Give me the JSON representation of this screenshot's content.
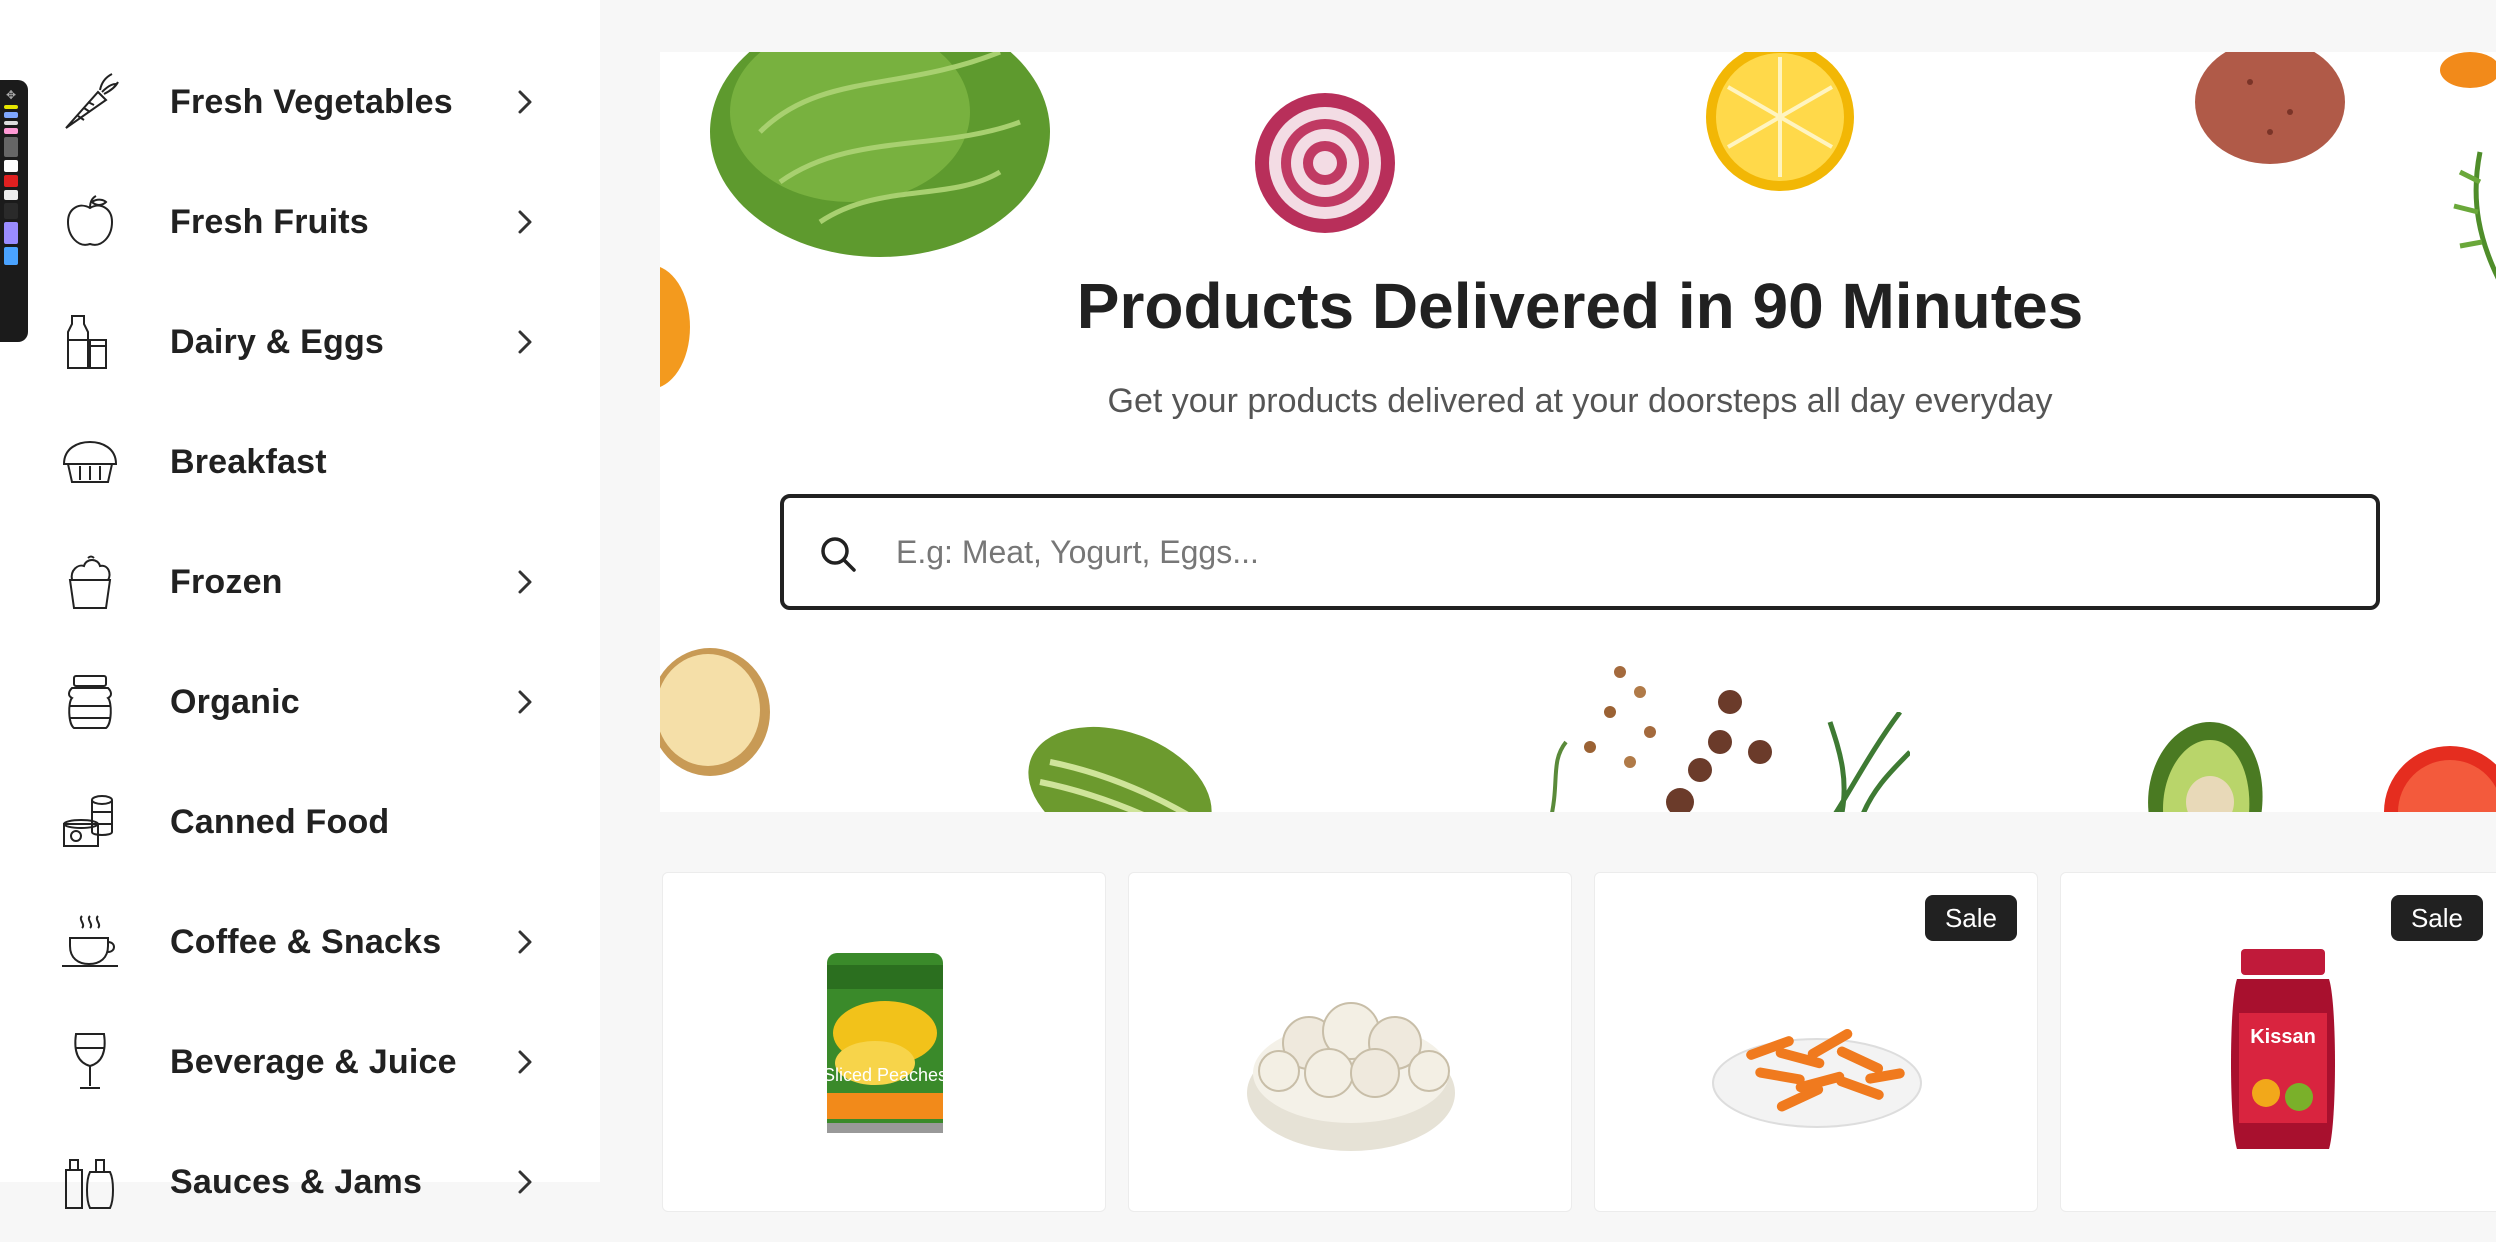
{
  "sidebar": {
    "categories": [
      {
        "label": "Fresh Vegetables",
        "icon": "carrot-icon",
        "has_submenu": true
      },
      {
        "label": "Fresh Fruits",
        "icon": "apple-icon",
        "has_submenu": true
      },
      {
        "label": "Dairy & Eggs",
        "icon": "milk-bottle-icon",
        "has_submenu": true
      },
      {
        "label": "Breakfast",
        "icon": "bread-icon",
        "has_submenu": false
      },
      {
        "label": "Frozen",
        "icon": "ice-cream-icon",
        "has_submenu": true
      },
      {
        "label": "Organic",
        "icon": "jar-icon",
        "has_submenu": true
      },
      {
        "label": "Canned Food",
        "icon": "canned-food-icon",
        "has_submenu": false
      },
      {
        "label": "Coffee & Snacks",
        "icon": "coffee-cup-icon",
        "has_submenu": true
      },
      {
        "label": "Beverage & Juice",
        "icon": "wine-glass-icon",
        "has_submenu": true
      },
      {
        "label": "Sauces & Jams",
        "icon": "sauce-bottles-icon",
        "has_submenu": true
      }
    ]
  },
  "hero": {
    "title": "Products Delivered in 90 Minutes",
    "subtitle": "Get your products delivered at your doorsteps all day everyday",
    "search_placeholder": "E.g: Meat, Yogurt, Eggs..."
  },
  "products": [
    {
      "badge": "",
      "image": "canned-peaches-image",
      "image_text": "Sliced Peaches"
    },
    {
      "badge": "",
      "image": "mushrooms-bowl-image"
    },
    {
      "badge": "Sale",
      "image": "baby-carrots-image"
    },
    {
      "badge": "Sale",
      "image": "mixed-fruit-jam-image",
      "image_text": "Kissan"
    }
  ],
  "colors": {
    "text": "#212121",
    "muted": "#555555",
    "badge_bg": "#212121",
    "page_bg": "#f7f7f7"
  }
}
